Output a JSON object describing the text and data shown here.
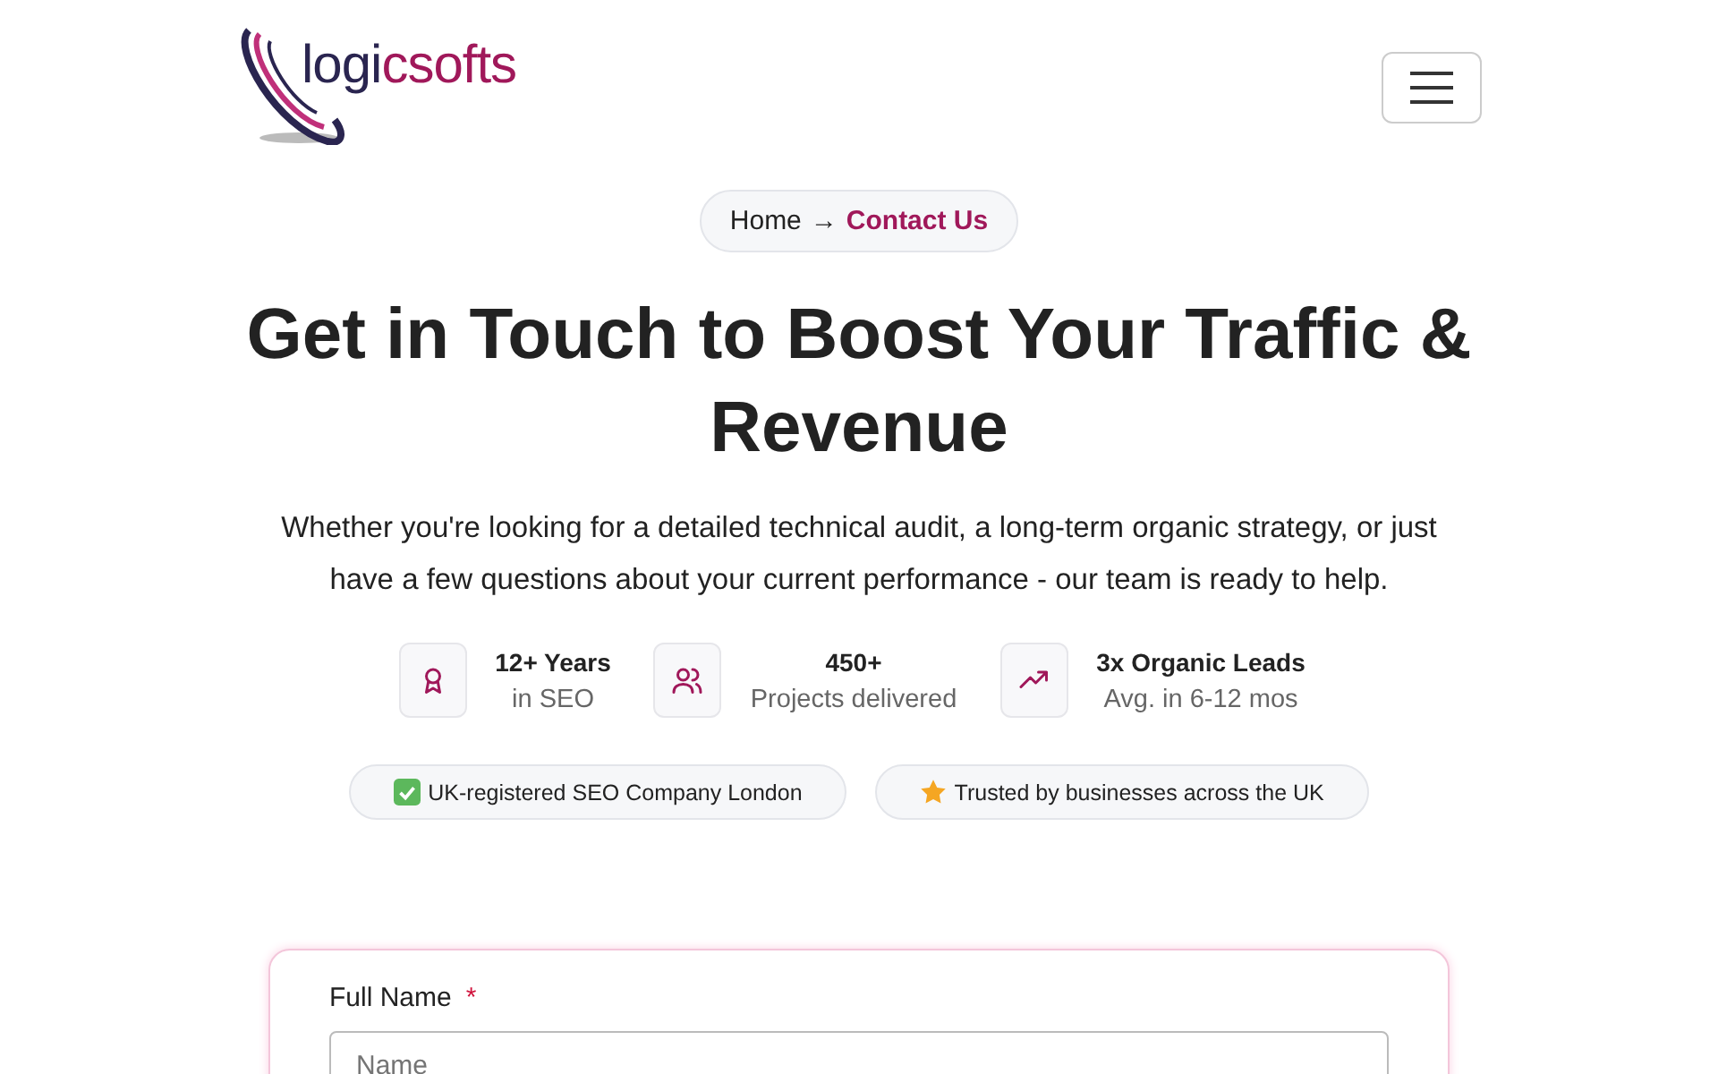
{
  "header": {
    "logo": {
      "text_dark": "logi",
      "text_accent": "csofts"
    }
  },
  "breadcrumb": {
    "separator": "→",
    "items": [
      {
        "label": "Home",
        "current": false
      },
      {
        "label": "Contact Us",
        "current": true
      }
    ]
  },
  "hero": {
    "title": "Get in Touch to Boost Your Traffic & Revenue",
    "subtitle": "Whether you're looking for a detailed technical audit, a long-term organic strategy, or just have a few questions about your current performance - our team is ready to help."
  },
  "stats": [
    {
      "kind": "award",
      "value": "12+ Years",
      "label": "in SEO"
    },
    {
      "kind": "users",
      "value": "450+",
      "label": "Projects delivered"
    },
    {
      "kind": "trend",
      "value": "3x Organic Leads",
      "label": "Avg. in 6-12 mos"
    }
  ],
  "badges": [
    {
      "kind": "check",
      "text": "UK-registered SEO Company London"
    },
    {
      "kind": "star",
      "text": "Trusted by businesses across the UK"
    }
  ],
  "form": {
    "fields": [
      {
        "label": "Full Name",
        "required": true,
        "required_mark": "*",
        "placeholder": "Name"
      }
    ]
  }
}
